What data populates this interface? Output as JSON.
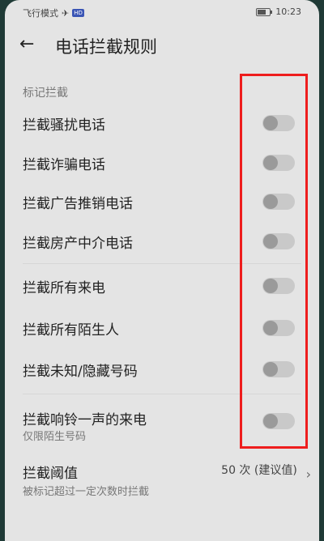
{
  "status_bar": {
    "left_text": "飞行模式",
    "hd_badge": "HD",
    "time": "10:23"
  },
  "header": {
    "back_icon": "arrow-left-icon",
    "title": "电话拦截规则"
  },
  "section": {
    "label": "标记拦截"
  },
  "rules": [
    {
      "label": "拦截骚扰电话",
      "enabled": false
    },
    {
      "label": "拦截诈骗电话",
      "enabled": false
    },
    {
      "label": "拦截广告推销电话",
      "enabled": false
    },
    {
      "label": "拦截房产中介电话",
      "enabled": false
    },
    {
      "label": "拦截所有来电",
      "enabled": false
    },
    {
      "label": "拦截所有陌生人",
      "enabled": false
    },
    {
      "label": "拦截未知/隐藏号码",
      "enabled": false
    },
    {
      "label": "拦截响铃一声的来电",
      "sub": "仅限陌生号码",
      "enabled": false
    }
  ],
  "threshold": {
    "label": "拦截阈值",
    "sub": "被标记超过一定次数时拦截",
    "value": "50 次 (建议值)"
  },
  "colors": {
    "highlight": "#ee1d1d",
    "toggle_off_track": "#c9c9c9",
    "toggle_off_knob": "#9a9a9a"
  }
}
